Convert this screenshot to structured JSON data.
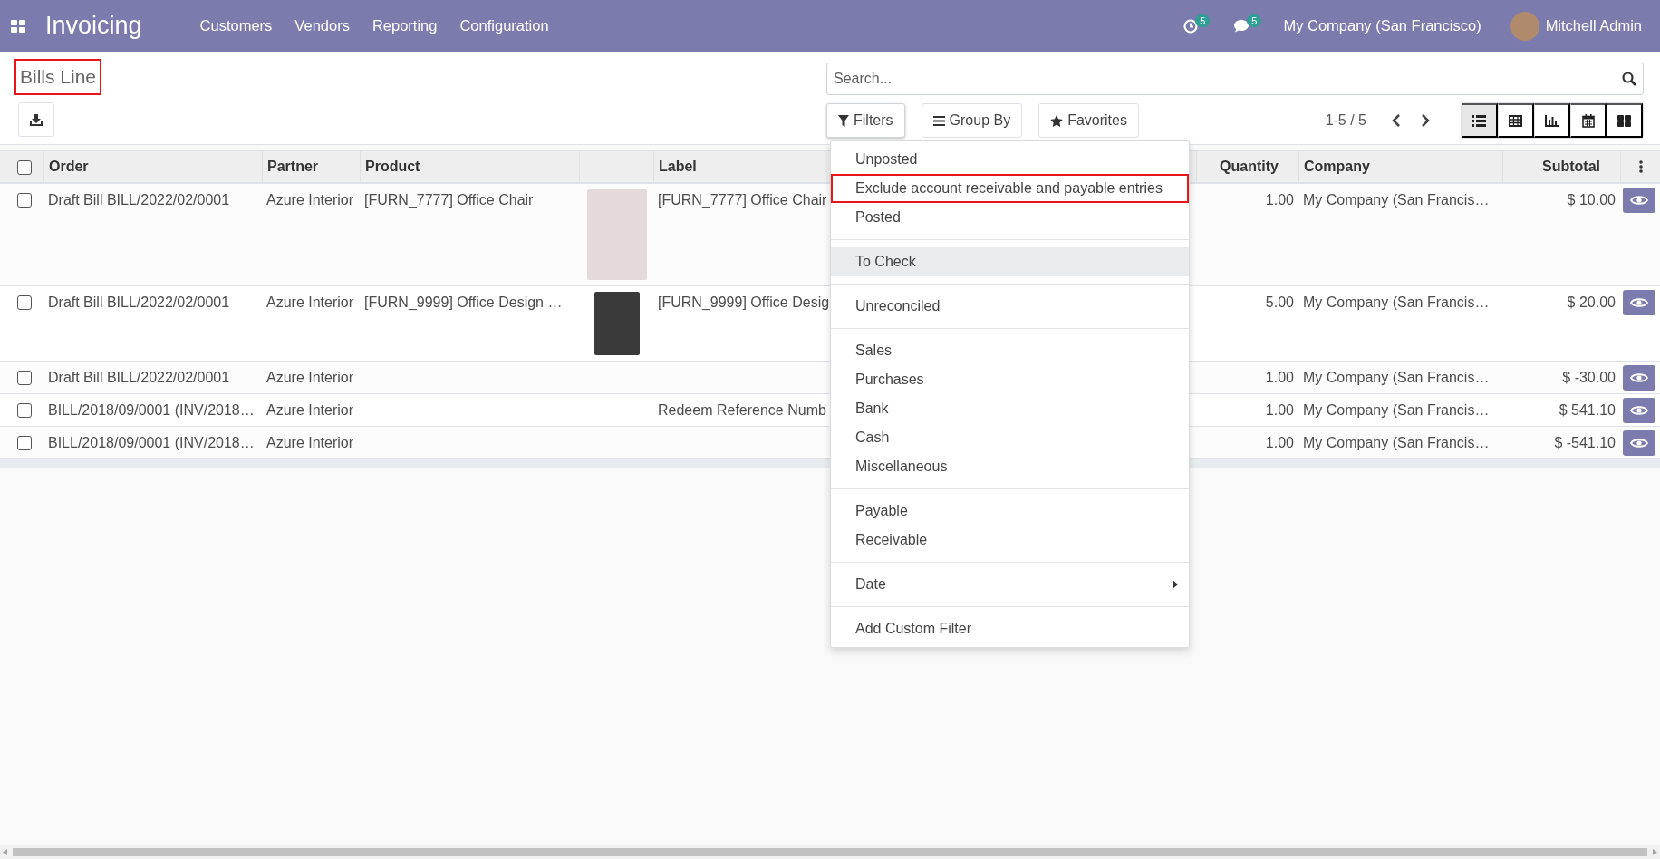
{
  "navbar": {
    "app_name": "Invoicing",
    "menu": [
      "Customers",
      "Vendors",
      "Reporting",
      "Configuration"
    ],
    "activity_count": "5",
    "message_count": "5",
    "company": "My Company (San Francisco)",
    "user": "Mitchell Admin"
  },
  "control_panel": {
    "title": "Bills Line",
    "title_highlighted": true,
    "search": {
      "placeholder": "Search..."
    },
    "search_buttons": [
      {
        "kind": "filter",
        "label": "Filters",
        "selected": true
      },
      {
        "kind": "group",
        "label": "Group By",
        "selected": false
      },
      {
        "kind": "star",
        "label": "Favorites",
        "selected": false
      }
    ],
    "pager": "1-5 / 5",
    "views": [
      {
        "kind": "list",
        "selected": true
      },
      {
        "kind": "pivot",
        "selected": false
      },
      {
        "kind": "graph",
        "selected": false
      },
      {
        "kind": "calendar",
        "selected": false
      },
      {
        "kind": "kanban",
        "selected": false
      }
    ]
  },
  "table": {
    "select_all_checked": false,
    "columns": [
      {
        "label": "Order",
        "kind": "text"
      },
      {
        "label": "Partner",
        "kind": "text"
      },
      {
        "label": "Product",
        "kind": "text"
      },
      {
        "kind": "image"
      },
      {
        "label": "Label",
        "kind": "text"
      },
      {
        "label": "Quantity",
        "kind": "number"
      },
      {
        "label": "Company",
        "kind": "text"
      },
      {
        "label": "Subtotal",
        "kind": "number"
      }
    ],
    "rows": [
      {
        "checked": false,
        "order": "Draft Bill BILL/2022/02/0001",
        "partner": "Azure Interior",
        "product": "[FURN_7777] Office Chair",
        "kind": "tall",
        "label": "[FURN_7777] Office Chair",
        "quantity": "1.00",
        "company": "My Company (San Francis…",
        "subtotal": "$ 10.00"
      },
      {
        "checked": false,
        "order": "Draft Bill BILL/2022/02/0001",
        "partner": "Azure Interior",
        "product": "[FURN_9999] Office Design …",
        "kind": "short",
        "label": "[FURN_9999] Office Desig",
        "quantity": "5.00",
        "company": "My Company (San Francis…",
        "subtotal": "$ 20.00"
      },
      {
        "checked": false,
        "order": "Draft Bill BILL/2022/02/0001",
        "partner": "Azure Interior",
        "quantity": "1.00",
        "company": "My Company (San Francis…",
        "subtotal": "$ -30.00"
      },
      {
        "checked": false,
        "order": "BILL/2018/09/0001 (INV/2018…",
        "partner": "Azure Interior",
        "label": "Redeem Reference Numb",
        "quantity": "1.00",
        "company": "My Company (San Francis…",
        "subtotal": "$ 541.10"
      },
      {
        "checked": false,
        "order": "BILL/2018/09/0001 (INV/2018…",
        "partner": "Azure Interior",
        "quantity": "1.00",
        "company": "My Company (San Francis…",
        "subtotal": "$ -541.10"
      }
    ]
  },
  "filter_menu": {
    "groups": [
      [
        {
          "label": "Unposted",
          "highlighted": false,
          "hovered": false,
          "has_submenu": false
        },
        {
          "label": "Exclude account receivable and payable entries",
          "highlighted": true,
          "hovered": false,
          "has_submenu": false
        },
        {
          "label": "Posted",
          "highlighted": false,
          "hovered": false,
          "has_submenu": false
        }
      ],
      [
        {
          "label": "To Check",
          "highlighted": false,
          "hovered": true,
          "has_submenu": false
        }
      ],
      [
        {
          "label": "Unreconciled",
          "highlighted": false,
          "hovered": false,
          "has_submenu": false
        }
      ],
      [
        {
          "label": "Sales",
          "highlighted": false,
          "hovered": false,
          "has_submenu": false
        },
        {
          "label": "Purchases",
          "highlighted": false,
          "hovered": false,
          "has_submenu": false
        },
        {
          "label": "Bank",
          "highlighted": false,
          "hovered": false,
          "has_submenu": false
        },
        {
          "label": "Cash",
          "highlighted": false,
          "hovered": false,
          "has_submenu": false
        },
        {
          "label": "Miscellaneous",
          "highlighted": false,
          "hovered": false,
          "has_submenu": false
        }
      ],
      [
        {
          "label": "Payable",
          "highlighted": false,
          "hovered": false,
          "has_submenu": false
        },
        {
          "label": "Receivable",
          "highlighted": false,
          "hovered": false,
          "has_submenu": false
        }
      ],
      [
        {
          "label": "Date",
          "highlighted": false,
          "hovered": false,
          "has_submenu": true
        }
      ],
      [
        {
          "label": "Add Custom Filter",
          "highlighted": false,
          "hovered": false,
          "has_submenu": false
        }
      ]
    ]
  }
}
